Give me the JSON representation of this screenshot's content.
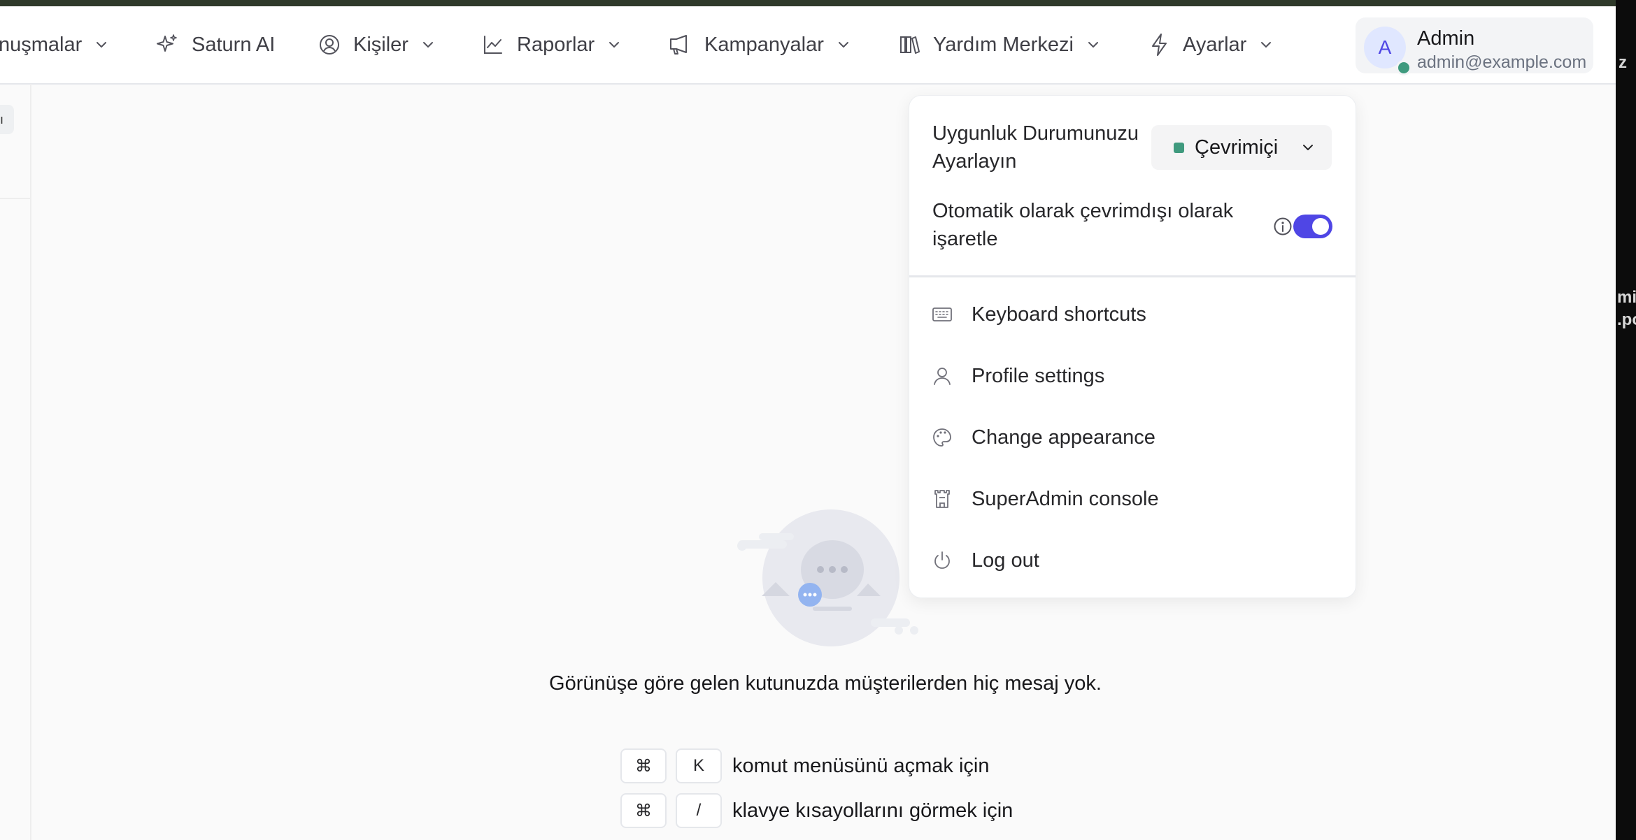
{
  "nav": {
    "items": [
      {
        "label": "nuşmalar",
        "icon": "chat-icon"
      },
      {
        "label": "Saturn AI",
        "icon": "sparkle-icon"
      },
      {
        "label": "Kişiler",
        "icon": "user-circle-icon"
      },
      {
        "label": "Raporlar",
        "icon": "chart-line-icon"
      },
      {
        "label": "Kampanyalar",
        "icon": "megaphone-icon"
      },
      {
        "label": "Yardım Merkezi",
        "icon": "library-icon"
      },
      {
        "label": "Ayarlar",
        "icon": "bolt-icon"
      }
    ]
  },
  "user": {
    "initial": "A",
    "name": "Admin",
    "email": "admin@example.com",
    "status_color": "#3f9a7e"
  },
  "sidebar": {
    "chip_text": "ı"
  },
  "dropdown": {
    "availability_label": "Uygunluk Durumunuzu Ayarlayın",
    "status_value": "Çevrimiçi",
    "auto_offline_label": "Otomatik olarak çevrimdışı olarak işaretle",
    "auto_offline_enabled": true,
    "menu": [
      {
        "label": "Keyboard shortcuts",
        "icon": "keyboard-icon"
      },
      {
        "label": "Profile settings",
        "icon": "user-icon"
      },
      {
        "label": "Change appearance",
        "icon": "palette-icon"
      },
      {
        "label": "SuperAdmin console",
        "icon": "castle-icon"
      },
      {
        "label": "Log out",
        "icon": "power-icon"
      }
    ]
  },
  "empty_state": {
    "message": "Görünüşe göre gelen kutunuzda müşterilerden hiç mesaj yok.",
    "shortcuts": [
      {
        "keys": [
          "⌘",
          "K"
        ],
        "text": "komut menüsünü açmak için"
      },
      {
        "keys": [
          "⌘",
          "/"
        ],
        "text": "klavye kısayollarını görmek için"
      }
    ]
  },
  "edge_fragments": [
    "z",
    "mi",
    ".po"
  ],
  "colors": {
    "accent": "#4f46e5",
    "online": "#3f9a7e",
    "top_strip": "#2f3a2a"
  }
}
